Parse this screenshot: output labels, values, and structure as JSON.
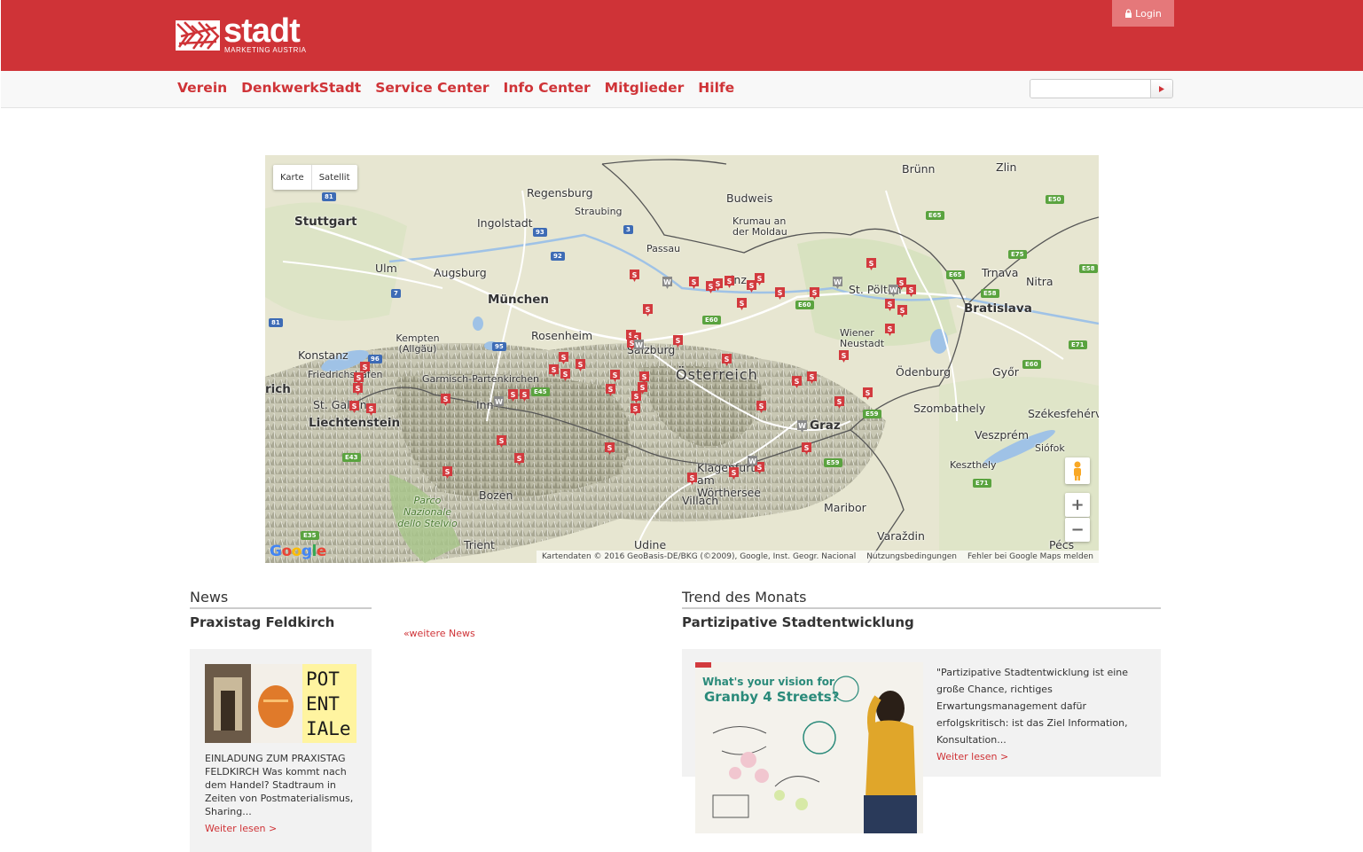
{
  "header": {
    "logo_title": "stadt",
    "logo_sub": "MARKETING AUSTRIA",
    "login_label": "Login"
  },
  "nav": {
    "items": [
      "Verein",
      "DenkwerkStadt",
      "Service Center",
      "Info Center",
      "Mitglieder",
      "Hilfe"
    ]
  },
  "search": {
    "value": "",
    "placeholder": ""
  },
  "map": {
    "type_buttons": [
      "Karte",
      "Satellit"
    ],
    "labels": {
      "bruenn": "Brünn",
      "zlin": "Zlin",
      "regensburg": "Regensburg",
      "budweis": "Budweis",
      "stuttgart": "Stuttgart",
      "straubing": "Straubing",
      "ingolstadt": "Ingolstadt",
      "krumau": "Krumau an der Moldau",
      "passau": "Passau",
      "ulm": "Ulm",
      "augsburg": "Augsburg",
      "trnava": "Trnava",
      "nitra": "Nitra",
      "muenchen": "München",
      "linz": "Linz",
      "bratislava": "Bratislava",
      "kempten": "Kempten (Allgäu)",
      "rosenheim": "Rosenheim",
      "salzburg": "Salzburg",
      "konstanz": "Konstanz",
      "friedrichshafen": "Friedrichshafen",
      "zuerich": "rich",
      "oesterreich": "Österreich",
      "oedenburg": "Ödenburg",
      "gyoer": "Győr",
      "garmisch": "Garmisch-Partenkirchen",
      "stgallen": "St. Gallen",
      "innsbruck": "Inn",
      "szombathely": "Szombathely",
      "szekesfehervar": "Székesfehérvár",
      "liechtenstein": "Liechtenstein",
      "graz": "Graz",
      "veszprem": "Veszprém",
      "siofok": "Siófok",
      "keszthely": "Keszthely",
      "klagenfurt": "Klagenfurt am Wörthersee",
      "bozen": "Bozen",
      "villach": "Villach",
      "maribor": "Maribor",
      "parco": "Parco Nazionale dello Stelvio",
      "trient": "Trient",
      "udine": "Udine",
      "varazdin": "Varaždin",
      "pecs": "Pécs",
      "wrneustadt": "Wiener Neustadt",
      "stpoelten": "St. Pölten"
    },
    "attribution": [
      "Kartendaten © 2016 GeoBasis-DE/BKG (©2009), Google, Inst. Geogr. Nacional",
      "Nutzungsbedingungen",
      "Fehler bei Google Maps melden"
    ],
    "google_logo": "Google",
    "marker_colors": {
      "stadt": "#d23a3e",
      "werk": "#8a8a8a"
    }
  },
  "news": {
    "section_title": "News",
    "article_title": "Praxistag Feldkirch",
    "more_link": "«weitere News",
    "image_text": [
      "POT",
      "ENT",
      "IALe"
    ],
    "excerpt": "EINLADUNG ZUM PRAXISTAG FELDKIRCH Was kommt nach dem Handel? Stadtraum in Zeiten von Postmaterialismus, Sharing...",
    "read_more": "Weiter lesen >"
  },
  "trend": {
    "section_title": "Trend des Monats",
    "article_title": "Partizipative Stadtentwicklung",
    "image_text": [
      "What's your vision for",
      "Granby 4 Streets?"
    ],
    "excerpt": "\"Partizipative Stadtentwicklung ist eine große Chance, richtiges Erwartungsmanagement dafür erfolgskritisch: ist das Ziel Information, Konsultation...",
    "read_more": "Weiter lesen >"
  },
  "colors": {
    "brand": "#cf3337",
    "login_bg": "#e5787a"
  }
}
